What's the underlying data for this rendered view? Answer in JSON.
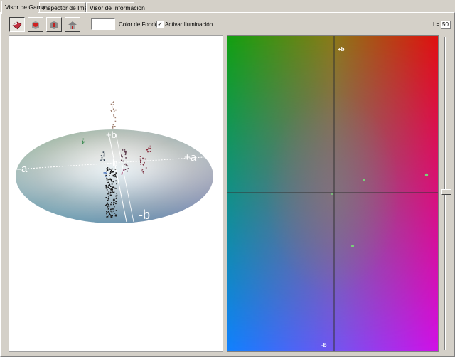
{
  "tabs": [
    {
      "label": "Visor de Gama",
      "active": true
    },
    {
      "label": "Inspector de Imagen",
      "active": false
    },
    {
      "label": "Visor de Información",
      "active": false
    }
  ],
  "toolbar": {
    "buttons": [
      {
        "name": "gamut-view-button",
        "icon": "gamut-shape-icon",
        "pressed": true
      },
      {
        "name": "box-red-button",
        "icon": "cube-red-icon",
        "pressed": false
      },
      {
        "name": "box-gray-button",
        "icon": "cube-gray-icon",
        "pressed": false
      },
      {
        "name": "room-button",
        "icon": "house-icon",
        "pressed": false
      }
    ],
    "background_color_label": "Color de Fondo",
    "background_color": "#ffffff",
    "lighting_label": "Activar Iluminación",
    "lighting_checked": true,
    "lightness_label": "L=",
    "lightness_value": "50"
  },
  "gamut_3d": {
    "axis_labels": {
      "plus_b": "+b",
      "minus_b": "-b",
      "plus_a": "+a",
      "minus_a": "-a",
      "center": "b"
    }
  },
  "ab_plane": {
    "axis_labels": {
      "plus_b": "+b",
      "minus_b": "-b"
    },
    "lightness_slider_fraction": 0.5
  }
}
